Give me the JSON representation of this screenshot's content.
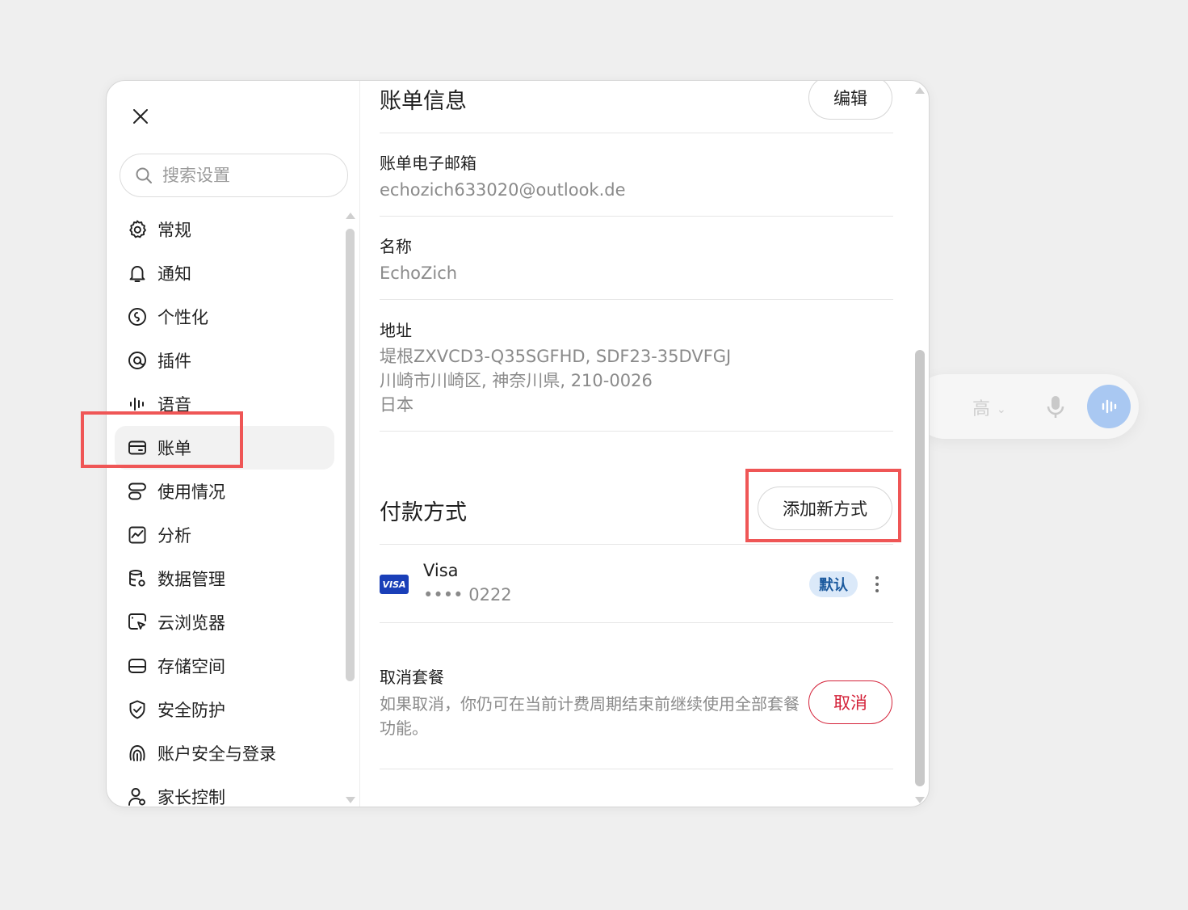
{
  "background": {
    "quality_label": "高"
  },
  "sidebar": {
    "search_placeholder": "搜索设置",
    "items": [
      {
        "label": "常规",
        "icon": "gear-icon"
      },
      {
        "label": "通知",
        "icon": "bell-icon"
      },
      {
        "label": "个性化",
        "icon": "palette-icon"
      },
      {
        "label": "插件",
        "icon": "plugin-icon"
      },
      {
        "label": "语音",
        "icon": "waveform-icon"
      },
      {
        "label": "账单",
        "icon": "credit-card-icon",
        "active": true
      },
      {
        "label": "使用情况",
        "icon": "usage-icon"
      },
      {
        "label": "分析",
        "icon": "analytics-icon"
      },
      {
        "label": "数据管理",
        "icon": "database-icon"
      },
      {
        "label": "云浏览器",
        "icon": "cloud-browser-icon"
      },
      {
        "label": "存储空间",
        "icon": "storage-icon"
      },
      {
        "label": "安全防护",
        "icon": "shield-icon"
      },
      {
        "label": "账户安全与登录",
        "icon": "fingerprint-icon"
      },
      {
        "label": "家长控制",
        "icon": "parent-icon"
      }
    ]
  },
  "billing_info": {
    "title": "账单信息",
    "edit_label": "编辑",
    "email_label": "账单电子邮箱",
    "email_value": "echozich633020@outlook.de",
    "name_label": "名称",
    "name_value": "EchoZich",
    "address_label": "地址",
    "address_lines": [
      "堤根ZXVCD3-Q35SGFHD, SDF23-35DVFGJ",
      "川崎市川崎区, 神奈川県, 210-0026",
      "日本"
    ]
  },
  "payment": {
    "title": "付款方式",
    "add_label": "添加新方式",
    "card_brand_logo": "VISA",
    "card_name": "Visa",
    "card_number": "•••• 0222",
    "default_badge": "默认"
  },
  "cancel_plan": {
    "label": "取消套餐",
    "description": "如果取消，你仍可在当前计费周期结束前继续使用全部套餐功能。",
    "button_label": "取消"
  },
  "colors": {
    "highlight": "#ef5656",
    "cancel_red": "#d4233a",
    "badge_bg": "#dbe9f9",
    "badge_text": "#1c5a9e",
    "visa_blue": "#1a3fb8"
  }
}
